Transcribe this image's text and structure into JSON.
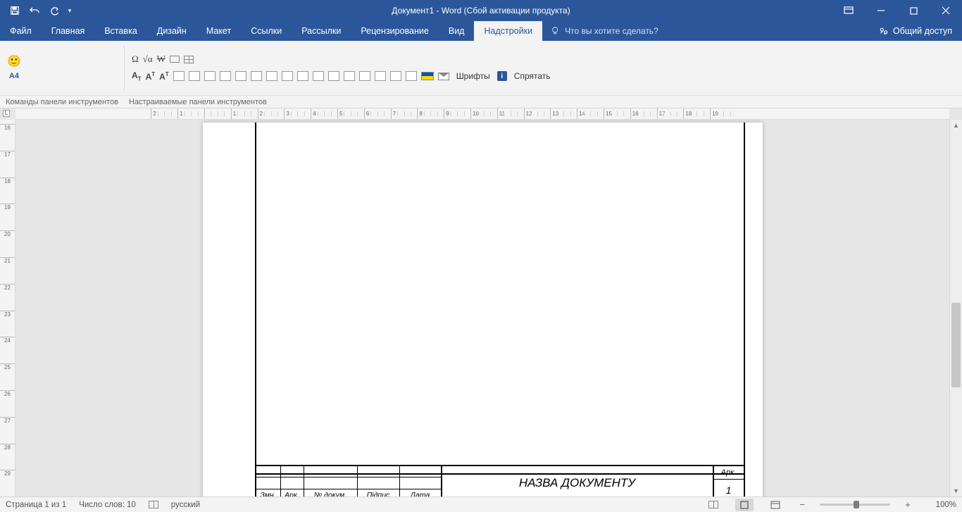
{
  "titlebar": {
    "title": "Документ1 - Word (Сбой активации продукта)"
  },
  "tabs": {
    "items": [
      "Файл",
      "Главная",
      "Вставка",
      "Дизайн",
      "Макет",
      "Ссылки",
      "Рассылки",
      "Рецензирование",
      "Вид",
      "Надстройки"
    ],
    "active": 9,
    "tell_me_placeholder": "Что вы хотите сделать?",
    "share": "Общий доступ"
  },
  "ribbon": {
    "group1_caption": "Команды панели инструментов",
    "group2_caption": "Настраиваемые панели инструментов",
    "a4_label": "A4",
    "fonts_btn": "Шрифты",
    "hide_btn": "Спрятать"
  },
  "document": {
    "title_block": {
      "name_label": "НАЗВА ДОКУМЕНТУ",
      "ark_label": "Арк.",
      "page_no": "1",
      "cols": {
        "zmn": "Змн.",
        "ark": "Арк.",
        "doc": "№ докум.",
        "sign": "Підпис",
        "date": "Дата"
      }
    }
  },
  "status": {
    "page": "Страница 1 из 1",
    "words": "Число слов: 10",
    "lang": "русский",
    "zoom": "100%"
  },
  "hruler_labels": [
    "2",
    "1",
    "",
    "1",
    "2",
    "3",
    "4",
    "5",
    "6",
    "7",
    "8",
    "9",
    "10",
    "11",
    "12",
    "13",
    "14",
    "15",
    "16",
    "17",
    "18",
    "19"
  ],
  "vruler_labels": [
    "16",
    "17",
    "18",
    "19",
    "20",
    "21",
    "22",
    "23",
    "24",
    "25",
    "26",
    "27",
    "28",
    "29"
  ]
}
